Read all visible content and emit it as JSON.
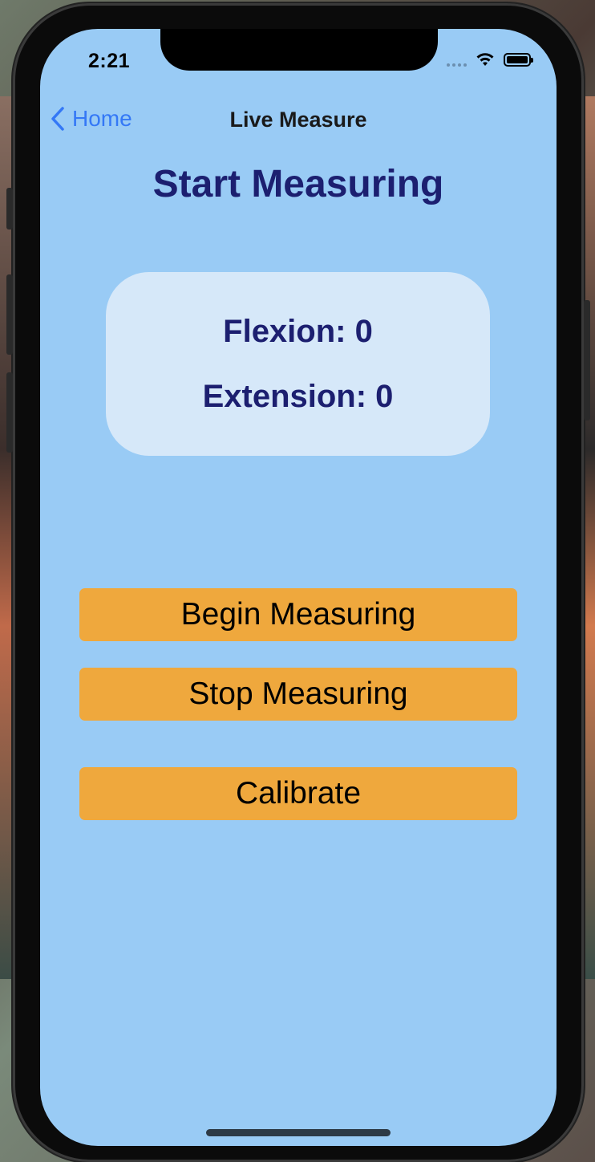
{
  "status_bar": {
    "time": "2:21",
    "icons": [
      "cellular-signal-icon",
      "wifi-icon",
      "battery-icon"
    ]
  },
  "nav": {
    "back_label": "Home",
    "back_icon": "chevron-left-icon",
    "title": "Live Measure"
  },
  "main": {
    "heading": "Start Measuring",
    "readout": {
      "flexion": "Flexion: 0",
      "extension": "Extension: 0"
    },
    "buttons": {
      "begin": "Begin Measuring",
      "stop": "Stop Measuring",
      "calibrate": "Calibrate"
    }
  },
  "colors": {
    "background": "#99cbf5",
    "card": "#d6e8f9",
    "heading_text": "#1c1f70",
    "button": "#efa83d",
    "back_link": "#3478f6"
  }
}
